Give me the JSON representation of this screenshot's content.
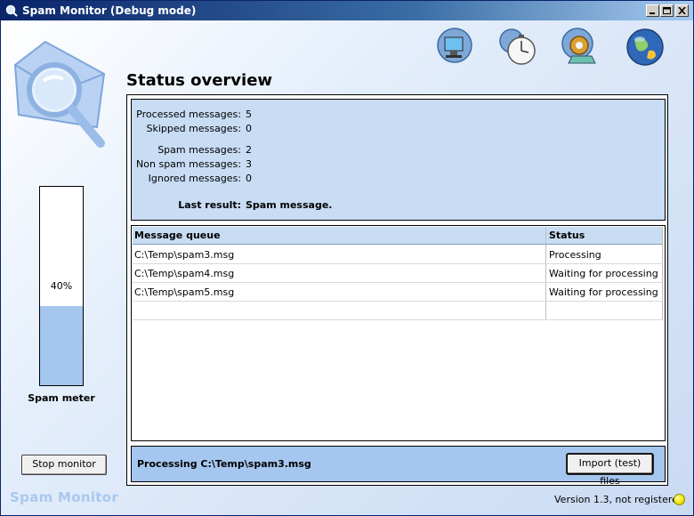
{
  "window": {
    "title": "Spam Monitor (Debug mode)"
  },
  "toolbar": {
    "icons": [
      "monitor-icon",
      "clock-icon",
      "settings-icon",
      "globe-icon"
    ]
  },
  "sidebar": {
    "meter_label": "Spam meter",
    "meter_percent_text": "40%",
    "meter_fraction": 0.4,
    "stop_button": "Stop monitor",
    "brand": "Spam Monitor"
  },
  "main": {
    "title": "Status overview",
    "stats": [
      {
        "label": "Processed messages:",
        "value": "5"
      },
      {
        "label": "Skipped messages:",
        "value": "0"
      },
      {
        "label": "Spam messages:",
        "value": "2"
      },
      {
        "label": "Non spam messages:",
        "value": "3"
      },
      {
        "label": "Ignored messages:",
        "value": "0"
      }
    ],
    "last_result": {
      "label": "Last result:",
      "value": "Spam message."
    },
    "queue": {
      "columns": [
        "Message queue",
        "Status"
      ],
      "rows": [
        {
          "file": "C:\\Temp\\spam3.msg",
          "status": "Processing"
        },
        {
          "file": "C:\\Temp\\spam4.msg",
          "status": "Waiting for processing"
        },
        {
          "file": "C:\\Temp\\spam5.msg",
          "status": "Waiting for processing"
        }
      ]
    },
    "footer": {
      "processing": "Processing C:\\Temp\\spam3.msg",
      "import_button": "Import (test) files"
    }
  },
  "status": {
    "version": "Version 1.3, not registered",
    "indicator_color": "#f2e400"
  },
  "colors": {
    "title_gradient_start": "#0a246a",
    "panel_blue": "#c8dcf4",
    "footer_blue": "#a5c6ee",
    "brand_text": "#a9c8ee"
  }
}
